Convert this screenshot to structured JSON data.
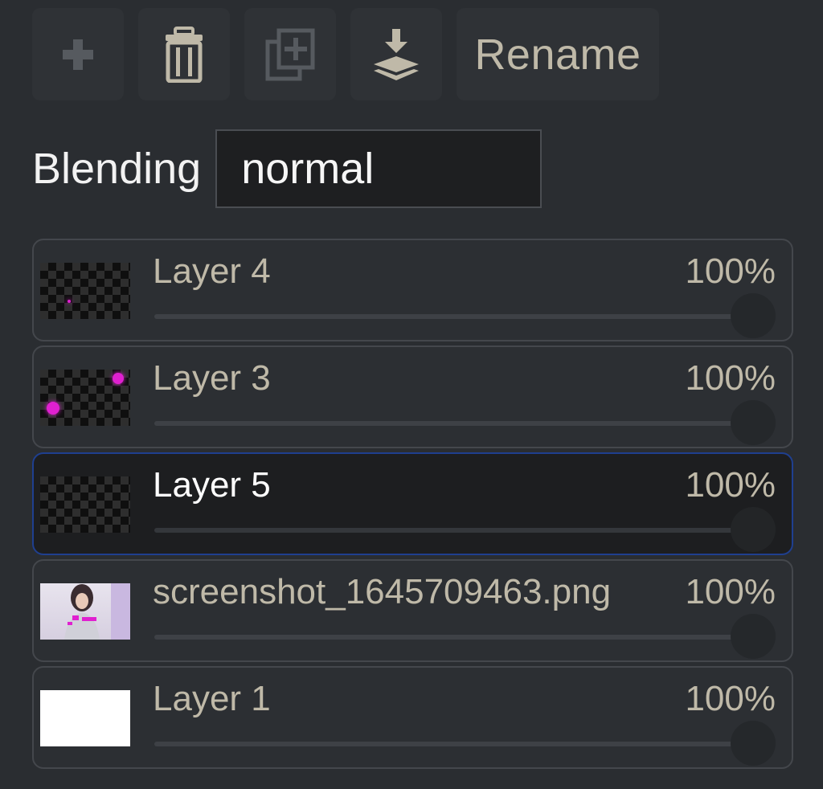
{
  "toolbar": {
    "buttons": [
      {
        "icon": "plus-icon"
      },
      {
        "icon": "trash-icon"
      },
      {
        "icon": "duplicate-icon"
      },
      {
        "icon": "merge-down-icon"
      }
    ],
    "rename_label": "Rename"
  },
  "blending": {
    "label": "Blending",
    "value": "normal"
  },
  "layers": [
    {
      "name": "Layer 4",
      "opacity": "100%",
      "thumbnail": "transparent-checker",
      "active": false
    },
    {
      "name": "Layer 3",
      "opacity": "100%",
      "thumbnail": "checker-with-magenta-dots",
      "active": false
    },
    {
      "name": "Layer 5",
      "opacity": "100%",
      "thumbnail": "transparent-checker",
      "active": true
    },
    {
      "name": "screenshot_1645709463.png",
      "opacity": "100%",
      "thumbnail": "photo",
      "active": false
    },
    {
      "name": "Layer 1",
      "opacity": "100%",
      "thumbnail": "white",
      "active": false
    }
  ],
  "colors": {
    "background": "#2a2d31",
    "active_border": "#1f3f8f",
    "text_muted": "#bfb9a8",
    "accent_magenta": "#e020d0"
  }
}
